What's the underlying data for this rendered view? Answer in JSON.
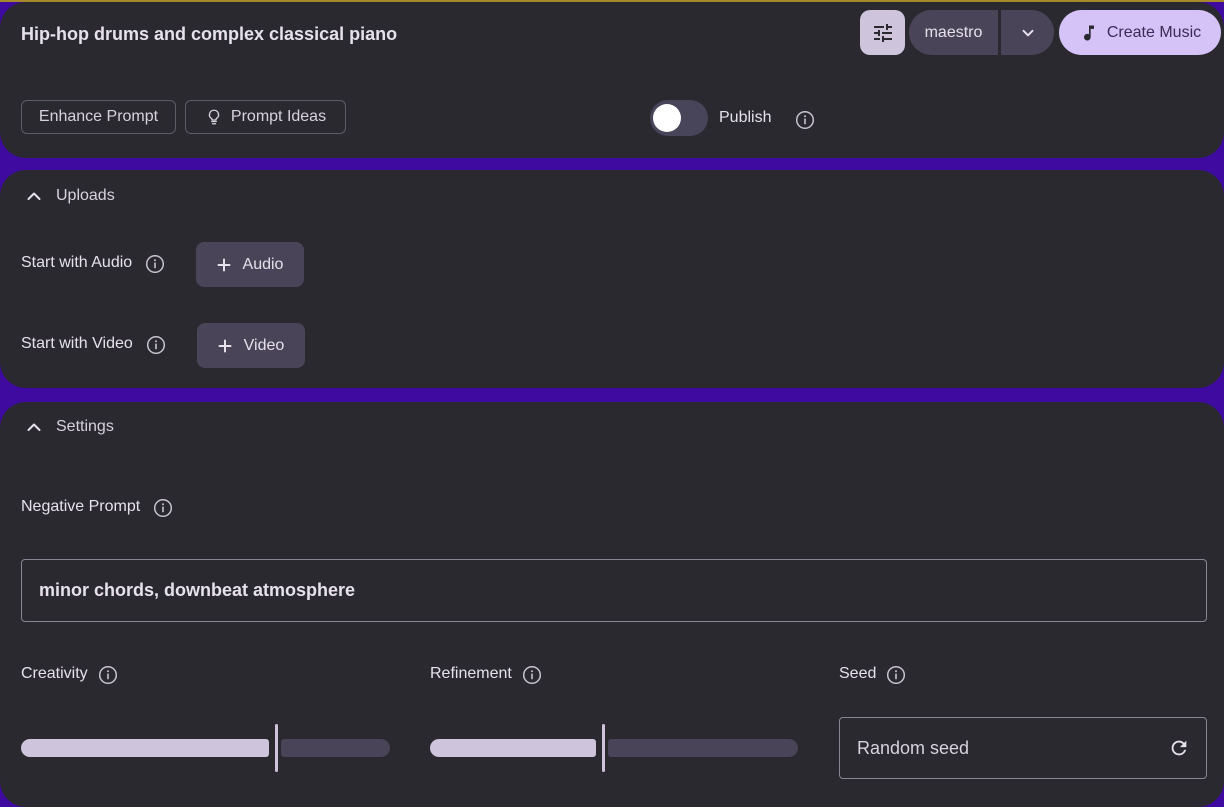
{
  "prompt": {
    "text": "Hip-hop drums and complex classical piano"
  },
  "toolbar": {
    "advanced_icon": "tune-icon",
    "model": "maestro",
    "create_label": "Create Music",
    "create_icon": "music-note-icon"
  },
  "actions": {
    "enhance_label": "Enhance Prompt",
    "ideas_label": "Prompt Ideas",
    "ideas_icon": "lightbulb-icon",
    "publish_label": "Publish",
    "publish_on": false
  },
  "uploads": {
    "title": "Uploads",
    "audio_label": "Start with Audio",
    "audio_button": "Audio",
    "video_label": "Start with Video",
    "video_button": "Video"
  },
  "settings": {
    "title": "Settings",
    "negative_label": "Negative Prompt",
    "negative_value": "minor chords, downbeat atmosphere",
    "creativity_label": "Creativity",
    "creativity_value": 0.69,
    "refinement_label": "Refinement",
    "refinement_value": 0.47,
    "seed_label": "Seed",
    "seed_placeholder": "Random seed"
  },
  "colors": {
    "background": "#3e0aa0",
    "card": "#2b2930",
    "accent": "#d5c2f7",
    "tonal": "#4a4458"
  }
}
